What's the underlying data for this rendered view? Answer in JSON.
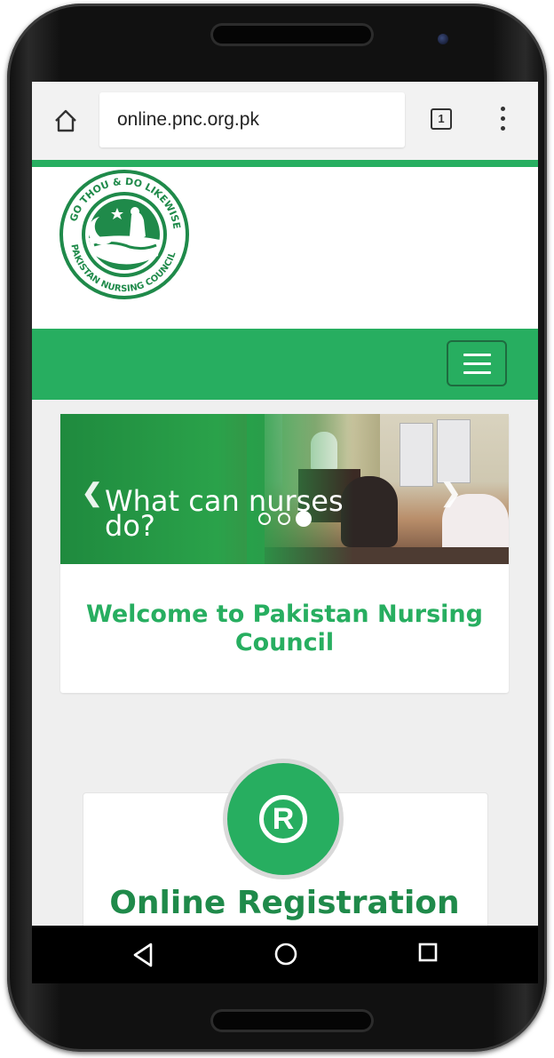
{
  "browser": {
    "url": "online.pnc.org.pk",
    "tab_count": "1"
  },
  "logo": {
    "text_top": "GO THOU & DO LIKEWISE",
    "text_bottom": "PAKISTAN NURSING COUNCIL",
    "colors": {
      "primary": "#1f8a4a"
    }
  },
  "carousel": {
    "caption": "What can nurses do?",
    "slide_count": 3,
    "active_slide": 3
  },
  "welcome": {
    "title": "Welcome to Pakistan Nursing Council"
  },
  "registration": {
    "icon": "registered-icon",
    "symbol": "R",
    "title": "Online Registration"
  },
  "theme": {
    "accent": "#27ae60",
    "accent_dark": "#1e6b3f"
  }
}
